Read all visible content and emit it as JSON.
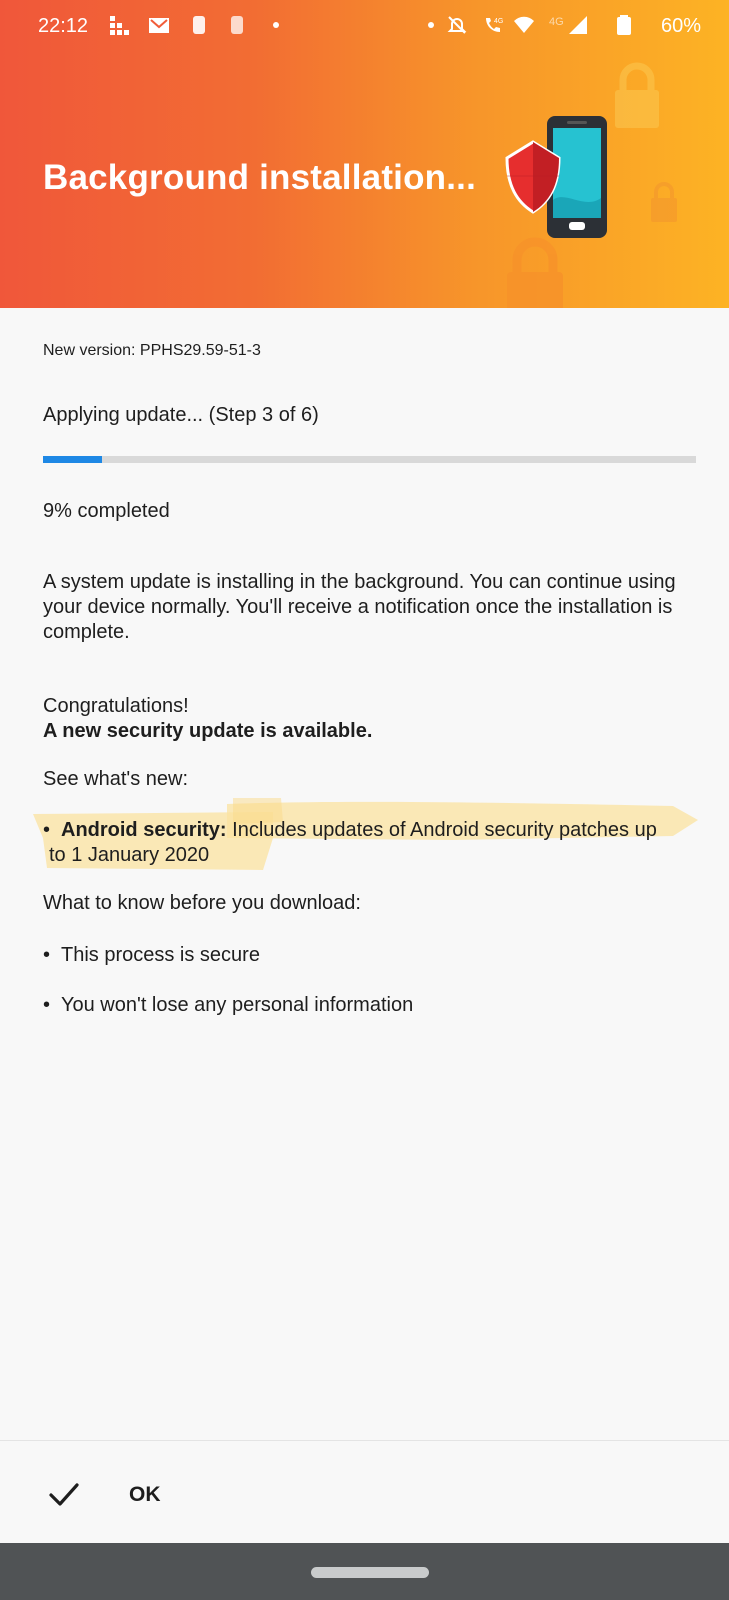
{
  "status_bar": {
    "time": "22:12",
    "battery": "60%",
    "icons": [
      "grid-icon",
      "gmail-icon",
      "app-icon",
      "app-icon",
      "dot-icon",
      "dot-icon",
      "mute-icon",
      "volte-4g-icon",
      "wifi-icon",
      "signal-4g-icon",
      "battery-icon"
    ]
  },
  "header": {
    "title": "Background installation..."
  },
  "update": {
    "version": "New version: PPHS29.59-51-3",
    "step": "Applying update... (Step 3 of 6)",
    "progress_fraction": 0.09,
    "percent_text": "9% completed",
    "description": "A system update is installing in the background. You can continue using your device normally. You'll receive a notification once the installation is complete."
  },
  "info": {
    "congrats": "Congratulations!",
    "headline": "A new security update is available.",
    "whats_new": "See what's new:",
    "bullet1_label": "Android security:",
    "bullet1_text": " Includes updates of Android security patches up",
    "bullet1_line2": "to 1 January 2020",
    "know_title": "What to know before you download:",
    "bullet2": "This process is secure",
    "bullet3": "You won't lose any personal information"
  },
  "footer": {
    "ok_label": "OK"
  },
  "colors": {
    "progress": "#1e88e5",
    "header_start": "#f0573a",
    "header_end": "#fdb324",
    "highlight": "#fce9a6"
  }
}
